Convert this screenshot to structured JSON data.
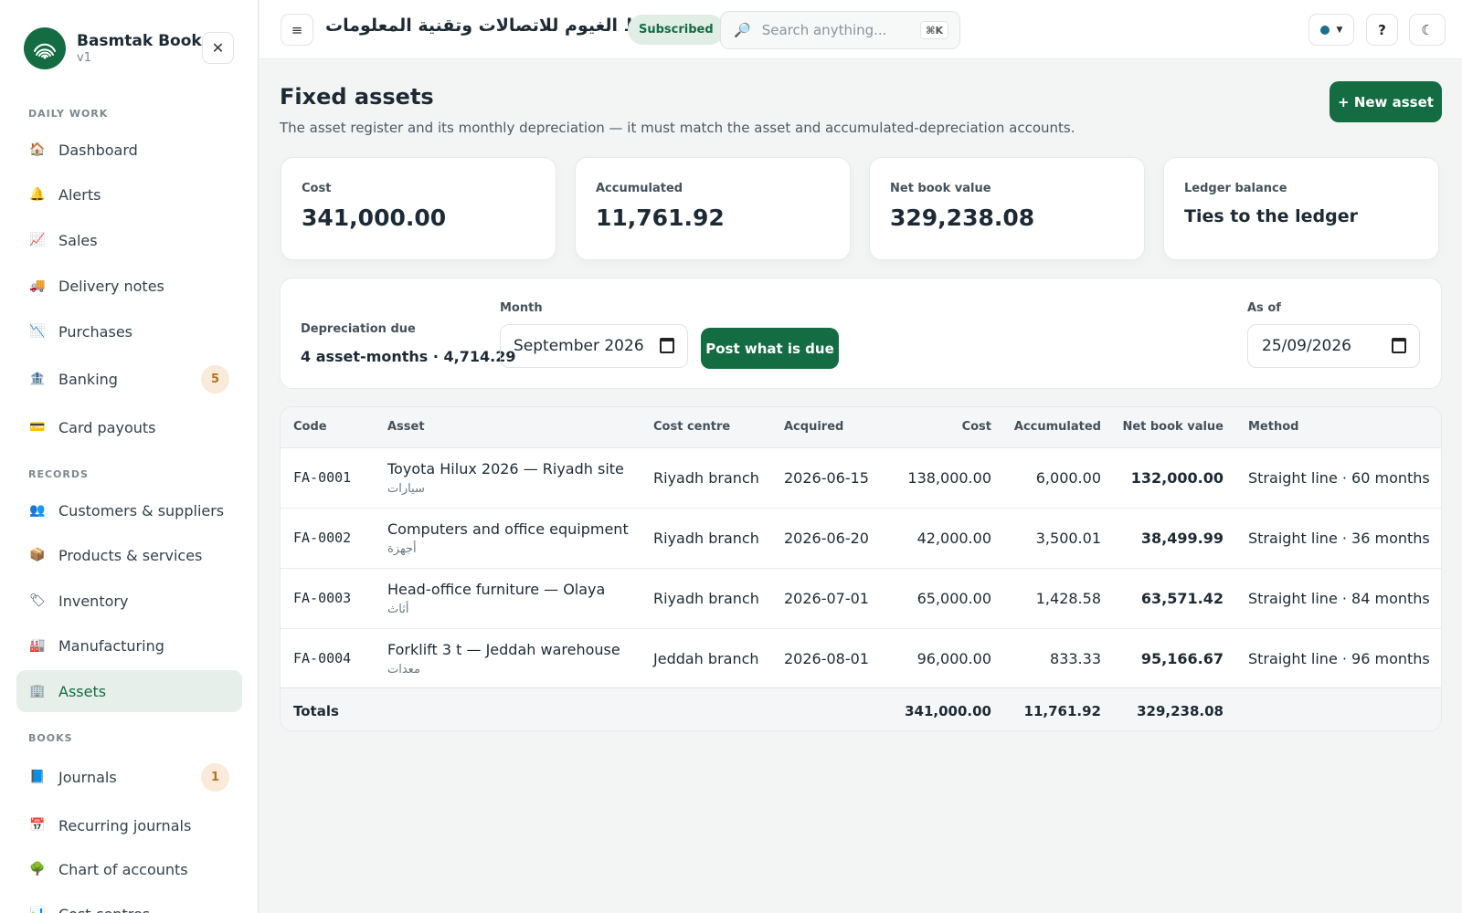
{
  "brand": {
    "name": "Basmtak Books",
    "version": "v1"
  },
  "sidebar": {
    "sections": [
      {
        "label": "DAILY WORK"
      },
      {
        "label": "RECORDS"
      },
      {
        "label": "BOOKS"
      }
    ],
    "items": [
      {
        "label": "Dashboard",
        "icon": "🏠"
      },
      {
        "label": "Alerts",
        "icon": "🔔"
      },
      {
        "label": "Sales",
        "icon": "📈"
      },
      {
        "label": "Delivery notes",
        "icon": "🚚"
      },
      {
        "label": "Purchases",
        "icon": "📉"
      },
      {
        "label": "Banking",
        "icon": "🏦",
        "badge": "5"
      },
      {
        "label": "Card payouts",
        "icon": "💳"
      },
      {
        "label": "Customers & suppliers",
        "icon": "👥"
      },
      {
        "label": "Products & services",
        "icon": "📦"
      },
      {
        "label": "Inventory",
        "icon": "🏷"
      },
      {
        "label": "Manufacturing",
        "icon": "🏭"
      },
      {
        "label": "Assets",
        "icon": "🏢"
      },
      {
        "label": "Journals",
        "icon": "📘",
        "badge": "1"
      },
      {
        "label": "Recurring journals",
        "icon": "📅"
      },
      {
        "label": "Chart of accounts",
        "icon": "🌳"
      },
      {
        "label": "Cost centres",
        "icon": "📊"
      }
    ]
  },
  "header": {
    "company": "خط الغيوم للاتصالات وتقنية المعلومات",
    "subscription": "Subscribed",
    "search_placeholder": "Search anything...",
    "shortcut": "⌘K",
    "help": "?",
    "status_color": "#1b6f8e"
  },
  "page": {
    "title": "Fixed assets",
    "description": "The asset register and its monthly depreciation — it must match the asset and accumulated-depreciation accounts.",
    "new_button": "+ New asset"
  },
  "stats": [
    {
      "label": "Cost",
      "value": "341,000.00"
    },
    {
      "label": "Accumulated",
      "value": "11,761.92"
    },
    {
      "label": "Net book value",
      "value": "329,238.08"
    },
    {
      "label": "Ledger balance",
      "value": "Ties to the ledger"
    }
  ],
  "depreciation": {
    "label": "Depreciation due",
    "value": "4 asset-months · 4,714.29",
    "month_label": "Month",
    "month_value": "September 2026",
    "post_button": "Post what is due",
    "asof_label": "As of",
    "asof_value": "25/09/2026"
  },
  "table": {
    "headers": [
      "Code",
      "Asset",
      "Cost centre",
      "Acquired",
      "Cost",
      "Accumulated",
      "Net book value",
      "Method"
    ],
    "rows": [
      {
        "code": "FA-0001",
        "asset": "Toyota Hilux 2026 — Riyadh site",
        "asset_sub": "سيارات",
        "cost_centre": "Riyadh branch",
        "acquired": "2026-06-15",
        "cost": "138,000.00",
        "accumulated": "6,000.00",
        "nbv": "132,000.00",
        "method": "Straight line · 60 months"
      },
      {
        "code": "FA-0002",
        "asset": "Computers and office equipment",
        "asset_sub": "أجهزة",
        "cost_centre": "Riyadh branch",
        "acquired": "2026-06-20",
        "cost": "42,000.00",
        "accumulated": "3,500.01",
        "nbv": "38,499.99",
        "method": "Straight line · 36 months"
      },
      {
        "code": "FA-0003",
        "asset": "Head-office furniture — Olaya",
        "asset_sub": "أثاث",
        "cost_centre": "Riyadh branch",
        "acquired": "2026-07-01",
        "cost": "65,000.00",
        "accumulated": "1,428.58",
        "nbv": "63,571.42",
        "method": "Straight line · 84 months"
      },
      {
        "code": "FA-0004",
        "asset": "Forklift 3 t — Jeddah warehouse",
        "asset_sub": "معدات",
        "cost_centre": "Jeddah branch",
        "acquired": "2026-08-01",
        "cost": "96,000.00",
        "accumulated": "833.33",
        "nbv": "95,166.67",
        "method": "Straight line · 96 months"
      }
    ],
    "totals": {
      "label": "Totals",
      "cost": "341,000.00",
      "accumulated": "11,761.92",
      "nbv": "329,238.08"
    }
  },
  "colors": {
    "accent": "#146c43",
    "accent_soft": "#e6efea",
    "badge_bg": "#f9ead9",
    "badge_fg": "#b5751f"
  }
}
